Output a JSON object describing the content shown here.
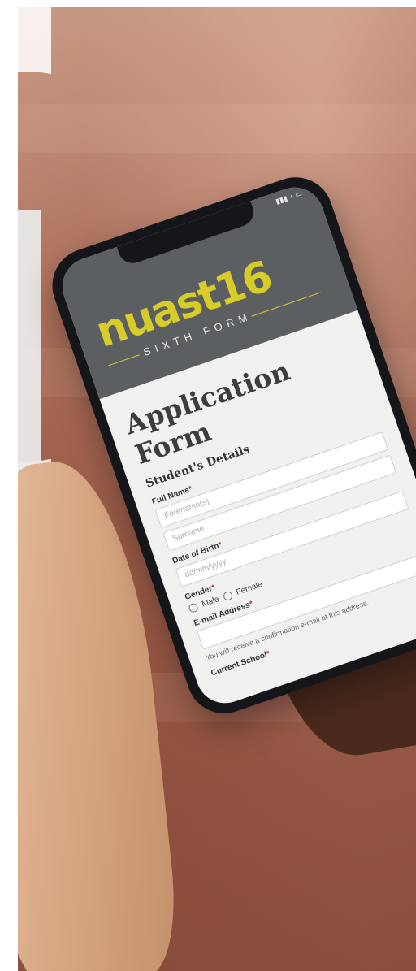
{
  "logo": {
    "brand": "nuast16",
    "tagline": "SIXTH FORM"
  },
  "form": {
    "title": "Application Form",
    "section": "Student's Details",
    "full_name": {
      "label": "Full Name",
      "required": "*",
      "placeholders": [
        "Forename(s)",
        "Surname"
      ]
    },
    "dob": {
      "label": "Date of Birth",
      "required": "*",
      "placeholder": "dd/mm/yyyy"
    },
    "gender": {
      "label": "Gender",
      "required": "*",
      "options": [
        "Male",
        "Female"
      ]
    },
    "email": {
      "label": "E-mail Address",
      "required": "*",
      "hint": "You will receive a confirmation e-mail at this address."
    },
    "school": {
      "label": "Current School",
      "required": "*"
    }
  },
  "icons": {
    "status": "signal-wifi-battery-icon"
  },
  "colors": {
    "brand_yellow": "#d7cc2a",
    "header_gray": "#5b5f62",
    "skin_light": "#e7c2a3",
    "skin_dark": "#4a2a1c"
  }
}
